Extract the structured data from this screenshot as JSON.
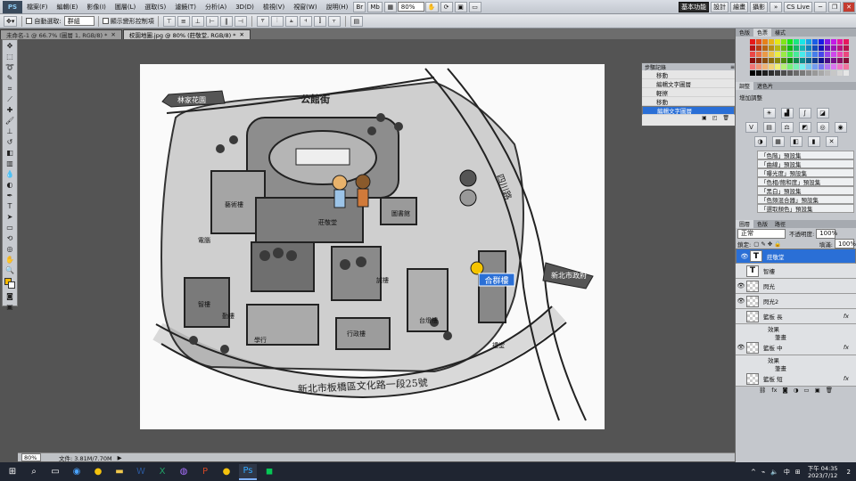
{
  "menubar": {
    "logo": "PS",
    "menus": [
      "檔案(F)",
      "編輯(E)",
      "影像(I)",
      "圖層(L)",
      "選取(S)",
      "濾鏡(T)",
      "分析(A)",
      "3D(D)",
      "檢視(V)",
      "視窗(W)",
      "說明(H)"
    ],
    "zoom": "80%",
    "workspaces": [
      "基本功能",
      "設計",
      "繪畫",
      "攝影"
    ],
    "cslive": "CS Live"
  },
  "options": {
    "auto_select_label": "自動選取:",
    "auto_select_value": "群組",
    "show_transform_label": "顯示變形控制項"
  },
  "tabs": [
    {
      "label": "未命名-1 @ 66.7% (圖層 1, RGB/8) *",
      "active": false
    },
    {
      "label": "校園地圖.jpg @ 80% (莊敬堂, RGB/8) *",
      "active": true
    }
  ],
  "history": {
    "title": "步驟記錄",
    "items": [
      "移動",
      "編輯文字圖層",
      "軽擦",
      "移動",
      "編輯文字圖層"
    ]
  },
  "map": {
    "street_top": "公館街",
    "sign_left": "林家花園",
    "sign_right": "新北市政府",
    "road_right": "四川路",
    "label_highlight": "合群樓",
    "address": "新北市板橋區文化路一段25號",
    "bldg_1": "智樓",
    "bldg_2": "勤樓",
    "bldg_3": "台燈樓",
    "bldg_4": "行政樓",
    "bldg_5": "莊敬堂",
    "bldg_6": "圖書館",
    "bldg_7": "誠樓",
    "bldg_8": "學行",
    "bldg_9": "藝術樓",
    "bldg_10": "電腦",
    "bldg_11": "禮堂"
  },
  "status": {
    "zoom": "80%",
    "doc": "文件: 3.81M/7.70M"
  },
  "dock": {
    "top_tabs": [
      "色版",
      "色票",
      "樣式"
    ],
    "adjust_tabs": [
      "調整",
      "遮色片"
    ],
    "adjust_title": "增加調整",
    "presets": [
      "「色階」預設集",
      "「曲線」預設集",
      "「曝光度」預設集",
      "「色相/飽和度」預設集",
      "「黑白」預設集",
      "「色頻混合器」預設集",
      "「選取顏色」預設集"
    ],
    "layer_tabs": [
      "圖層",
      "色版",
      "路徑"
    ],
    "blend_mode": "正常",
    "opacity_label": "不透明度:",
    "opacity": "100%",
    "lock_label": "鎖定:",
    "fill_label": "填滿:",
    "fill": "100%",
    "layers": [
      {
        "name": "莊敬堂",
        "type": "text",
        "selected": true,
        "visible": true,
        "fx": false
      },
      {
        "name": "智樓",
        "type": "text",
        "selected": false,
        "visible": false,
        "fx": false
      },
      {
        "name": "閃光",
        "type": "raster",
        "selected": false,
        "visible": true,
        "fx": false
      },
      {
        "name": "閃光2",
        "type": "raster",
        "selected": false,
        "visible": true,
        "fx": false
      },
      {
        "name": "籃板 長",
        "type": "raster",
        "selected": false,
        "visible": false,
        "fx": true
      },
      {
        "name": "籃板 中",
        "type": "raster",
        "selected": false,
        "visible": true,
        "fx": true
      },
      {
        "name": "籃板 短",
        "type": "raster",
        "selected": false,
        "visible": false,
        "fx": true
      }
    ],
    "effects_label": "效果",
    "stroke_label": "筆畫"
  },
  "taskbar": {
    "time": "下午 04:35",
    "date": "2023/7/12",
    "ime": "中",
    "notify": "2"
  },
  "colors": {
    "highlight_blue": "#2a6fd6",
    "foreground": "#f5b800",
    "background": "#ffffff"
  }
}
